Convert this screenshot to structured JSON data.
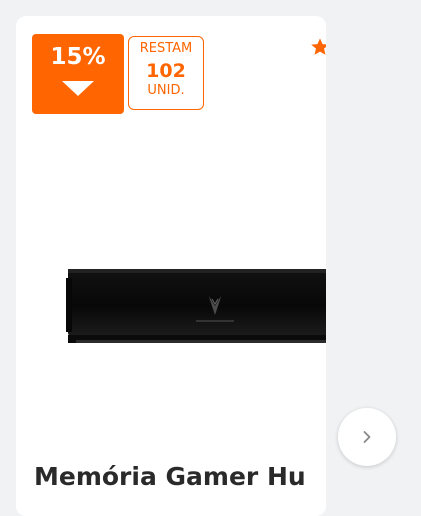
{
  "product": {
    "discount_label": "15%",
    "stock": {
      "top_label": "RESTAM",
      "count": "102",
      "bottom_label": "UNID."
    },
    "title": "Memória Gamer Hu"
  },
  "icons": {
    "discount_direction": "down-triangle-icon",
    "favorite": "star-icon",
    "next": "chevron-right-icon"
  },
  "colors": {
    "accent": "#ff6500",
    "background": "#f1f2f4",
    "card": "#ffffff",
    "title": "#2a2a2a"
  }
}
